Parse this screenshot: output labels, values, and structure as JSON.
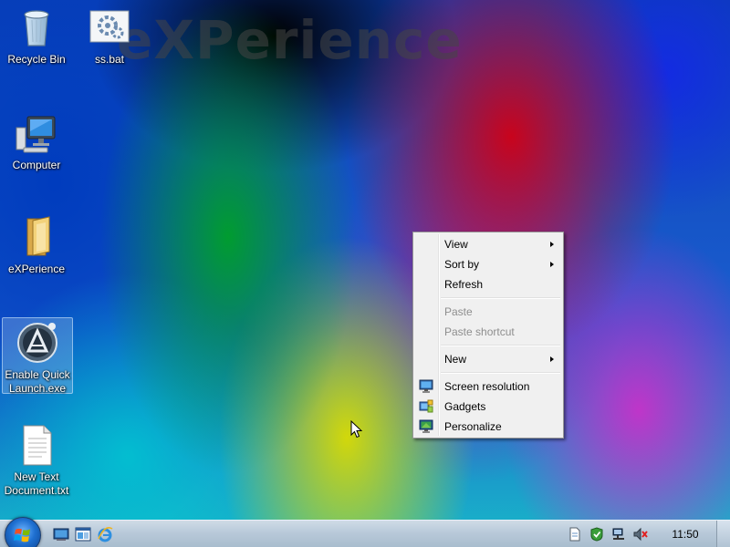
{
  "desktop": {
    "watermark": "eXPerience",
    "icons": [
      {
        "label": "Recycle Bin",
        "icon": "recycle-bin-icon"
      },
      {
        "label": "ss.bat",
        "icon": "batch-file-icon"
      },
      {
        "label": "Computer",
        "icon": "computer-icon"
      },
      {
        "label": "eXPerience",
        "icon": "folder-icon"
      },
      {
        "label": "Enable Quick Launch.exe",
        "icon": "app-exe-icon"
      },
      {
        "label": "New Text Document.txt",
        "icon": "text-document-icon"
      }
    ]
  },
  "context_menu": {
    "items": [
      {
        "label": "View",
        "submenu": true,
        "enabled": true
      },
      {
        "label": "Sort by",
        "submenu": true,
        "enabled": true
      },
      {
        "label": "Refresh",
        "submenu": false,
        "enabled": true
      },
      {
        "label": "Paste",
        "submenu": false,
        "enabled": false
      },
      {
        "label": "Paste shortcut",
        "submenu": false,
        "enabled": false
      },
      {
        "label": "New",
        "submenu": true,
        "enabled": true
      },
      {
        "label": "Screen resolution",
        "submenu": false,
        "enabled": true,
        "icon": "screen-resolution-icon"
      },
      {
        "label": "Gadgets",
        "submenu": false,
        "enabled": true,
        "icon": "gadgets-icon"
      },
      {
        "label": "Personalize",
        "submenu": false,
        "enabled": true,
        "icon": "personalize-icon"
      }
    ]
  },
  "taskbar": {
    "start_icon": "windows-start-icon",
    "quick_launch": [
      "show-desktop-icon",
      "switch-windows-icon",
      "internet-explorer-icon"
    ],
    "tray": [
      "document-icon",
      "action-center-icon",
      "network-icon",
      "volume-muted-icon"
    ],
    "clock": "11:50"
  },
  "colors": {
    "menu_background": "#f0f0f0",
    "menu_border": "#979797",
    "disabled_text": "#8e8e8e",
    "taskbar": "#b8c9d9"
  }
}
